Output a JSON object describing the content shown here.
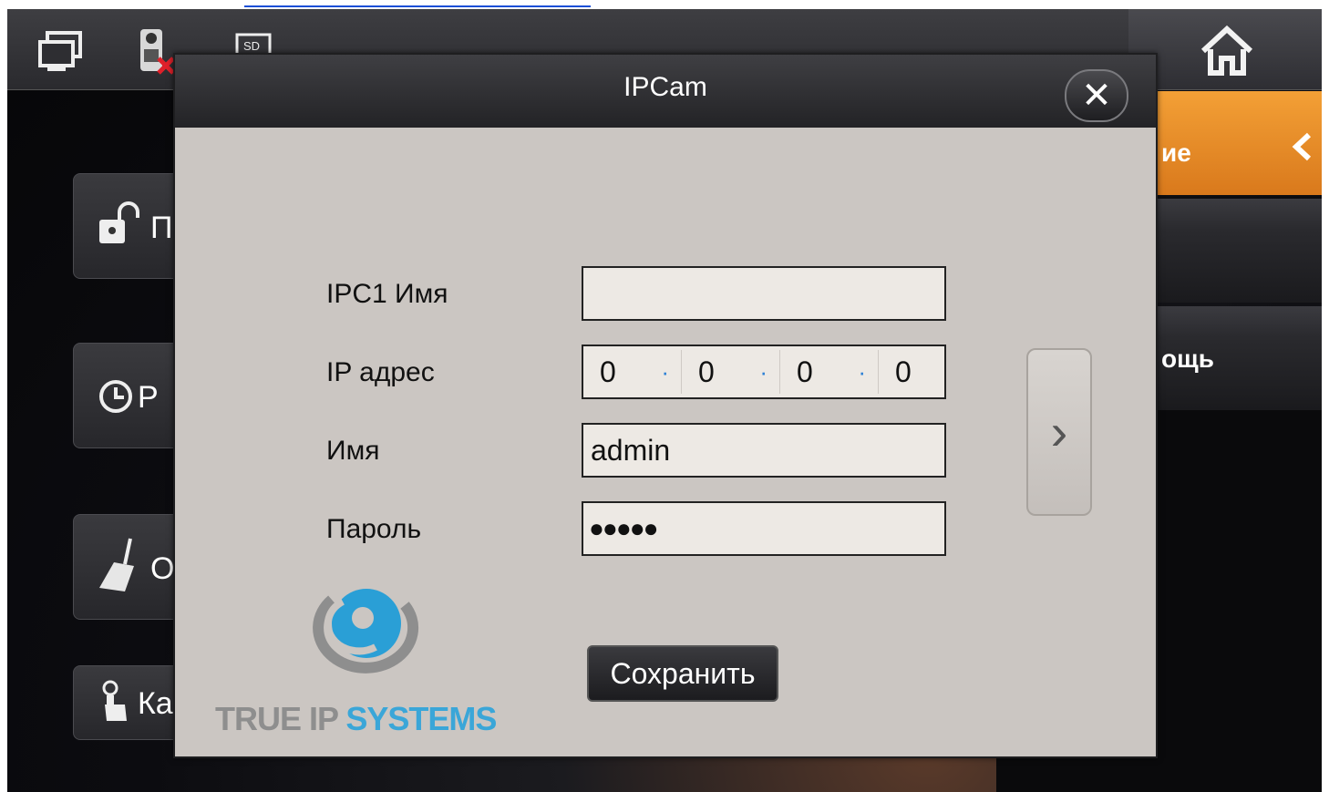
{
  "dialog": {
    "title": "IPCam",
    "fields": {
      "ipc_name_label": "IPC1 Имя",
      "ipc_name_value": "",
      "ip_label": "IP адрес",
      "ip_octets": [
        "0",
        "0",
        "0",
        "0"
      ],
      "ip_separator": "·",
      "user_label": "Имя",
      "user_value": "admin",
      "password_label": "Пароль",
      "password_value": "●●●●●"
    },
    "save_label": "Сохранить",
    "next_glyph": "›",
    "close_glyph": "✕"
  },
  "logo": {
    "part1": "TRUE IP",
    "part2": "SYSTEMS"
  },
  "background": {
    "left_tiles": [
      {
        "label": "П",
        "icon": "unlock-icon"
      },
      {
        "label": "Р",
        "icon": "clock-icon"
      },
      {
        "label": "О",
        "icon": "broom-icon"
      },
      {
        "label": "Ка",
        "icon": "hand-key-icon"
      }
    ],
    "right_menu": [
      {
        "label": "ие",
        "icon": "chevron-left-icon",
        "active": true
      },
      {
        "label": "",
        "active": false
      },
      {
        "label": "ощь",
        "active": false
      }
    ],
    "status_icons": [
      "monitor-icon",
      "intercom-error-icon",
      "sd-card-icon",
      "home-icon"
    ]
  },
  "colors": {
    "accent_orange": "#e88a2a",
    "dialog_bg": "#cbc6c2",
    "logo_blue": "#3aa6d8"
  }
}
